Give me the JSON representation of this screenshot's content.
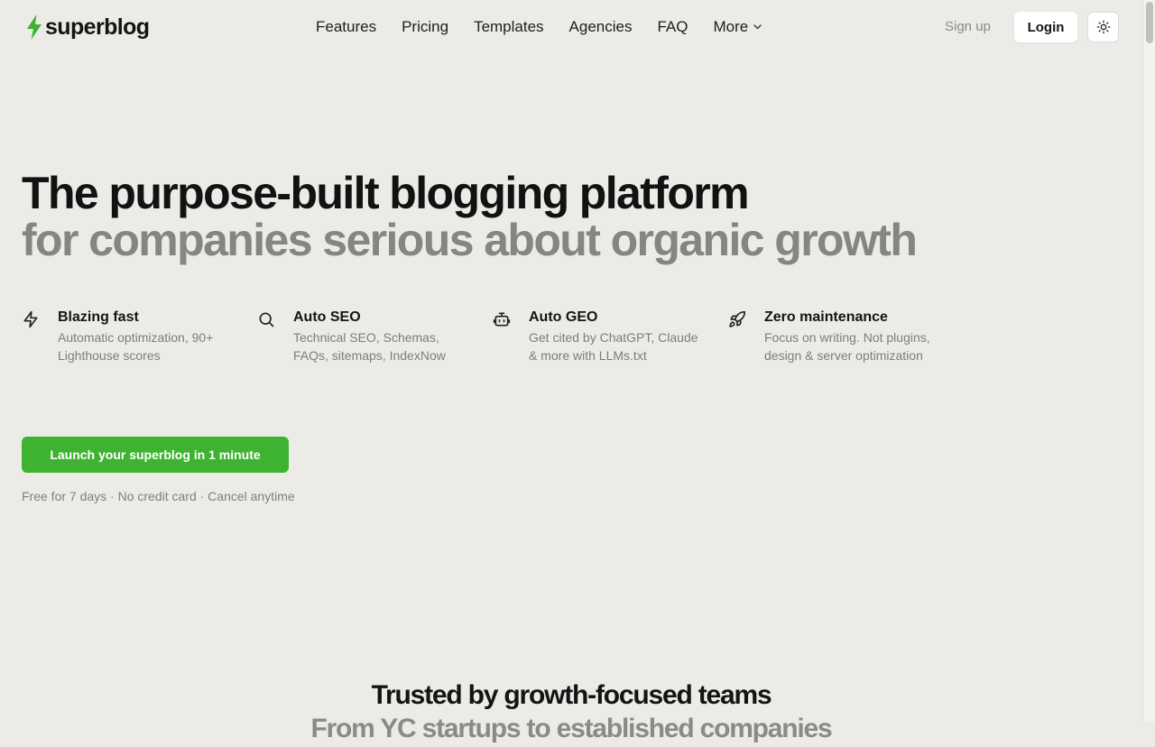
{
  "brand": {
    "name": "superblog",
    "accent": "#3eb331"
  },
  "nav": {
    "items": [
      "Features",
      "Pricing",
      "Templates",
      "Agencies",
      "FAQ",
      "More"
    ],
    "signup": "Sign up",
    "login": "Login"
  },
  "hero": {
    "title_line1": "The purpose-built blogging platform",
    "title_line2": "for companies serious about organic growth"
  },
  "features": [
    {
      "icon": "lightning-icon",
      "title": "Blazing fast",
      "desc": "Automatic optimization, 90+ Lighthouse scores"
    },
    {
      "icon": "search-icon",
      "title": "Auto SEO",
      "desc": "Technical SEO, Schemas, FAQs, sitemaps, IndexNow"
    },
    {
      "icon": "robot-icon",
      "title": "Auto GEO",
      "desc": "Get cited by ChatGPT, Claude & more with LLMs.txt"
    },
    {
      "icon": "rocket-icon",
      "title": "Zero maintenance",
      "desc": "Focus on writing. Not plugins, design & server optimization"
    }
  ],
  "cta": {
    "label": "Launch your superblog in 1 minute",
    "note": "Free for 7 days · No credit card · Cancel anytime"
  },
  "trusted": {
    "title": "Trusted by growth-focused teams",
    "subtitle": "From YC startups to established companies"
  }
}
